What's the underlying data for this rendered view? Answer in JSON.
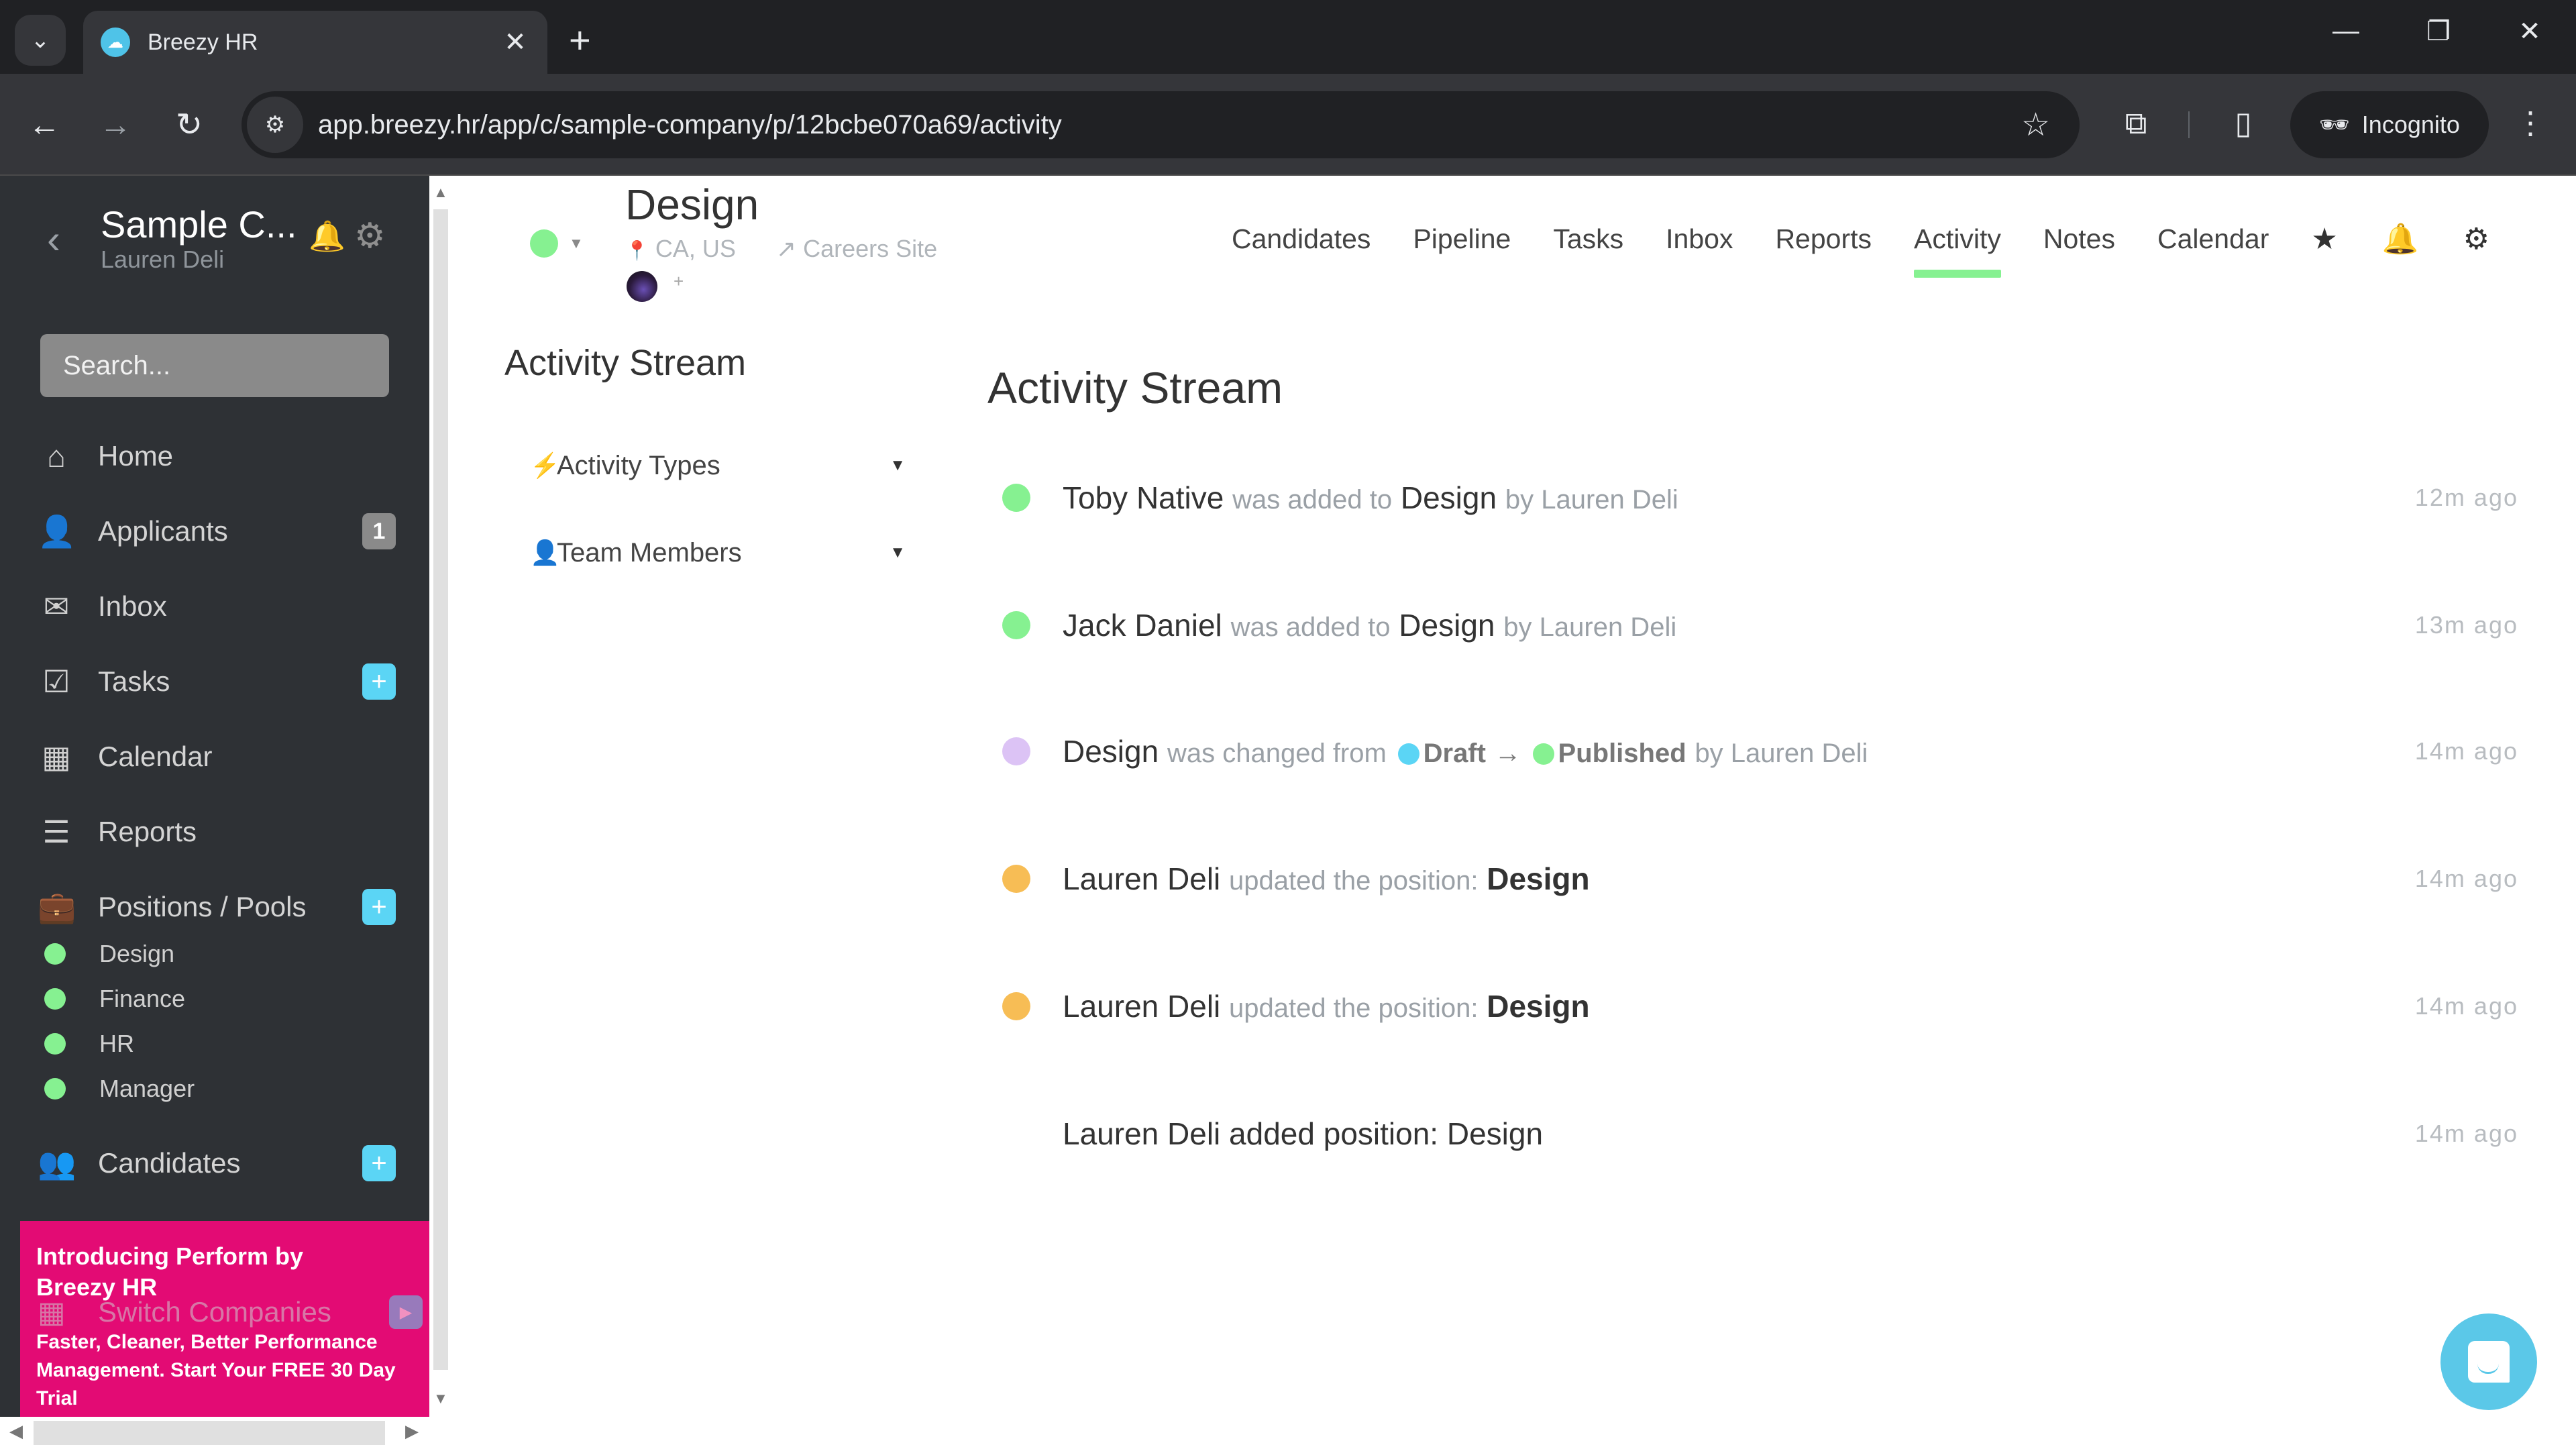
{
  "browser": {
    "tab_title": "Breezy HR",
    "url": "app.breezy.hr/app/c/sample-company/p/12bcbe070a69/activity",
    "incognito_label": "Incognito",
    "icons": {
      "tab_search": "⌄",
      "close": "✕",
      "new_tab": "+",
      "minimize": "—",
      "restore": "❐",
      "window_close": "✕",
      "back": "←",
      "forward": "→",
      "reload": "↻",
      "site_info": "⚙",
      "bookmark": "☆",
      "extensions": "⧉",
      "side_panel": "▯",
      "incognito": "🕶",
      "menu": "⋮"
    }
  },
  "sidebar": {
    "company": "Sample C...",
    "user": "Lauren Deli",
    "search_placeholder": "Search...",
    "icons": {
      "back": "‹",
      "bell": "🔔",
      "gear": "⚙"
    },
    "items": [
      {
        "label": "Home",
        "icon": "⌂"
      },
      {
        "label": "Applicants",
        "icon": "👤",
        "badge": "1"
      },
      {
        "label": "Inbox",
        "icon": "✉"
      },
      {
        "label": "Tasks",
        "icon": "☑",
        "badge": "+"
      },
      {
        "label": "Calendar",
        "icon": "▦"
      },
      {
        "label": "Reports",
        "icon": "☰"
      },
      {
        "label": "Positions / Pools",
        "icon": "💼",
        "badge": "+"
      },
      {
        "label": "Candidates",
        "icon": "👥",
        "badge": "+"
      }
    ],
    "positions": [
      {
        "label": "Design",
        "color": "#86f191"
      },
      {
        "label": "Finance",
        "color": "#86f191"
      },
      {
        "label": "HR",
        "color": "#86f191"
      },
      {
        "label": "Manager",
        "color": "#86f191"
      }
    ],
    "switch_companies": {
      "label": "Switch Companies",
      "icon": "▦",
      "go": "▶"
    },
    "promo": {
      "title": "Introducing Perform by Breezy HR",
      "body": "Faster, Cleaner, Better Performance Management. Start Your FREE 30 Day Trial"
    }
  },
  "position": {
    "title": "Design",
    "status_color": "#86f191",
    "location": "CA, US",
    "careers_link": "Careers Site",
    "icons": {
      "location": "📍",
      "external": "↗",
      "caret": "▼",
      "add": "+"
    }
  },
  "topnav": {
    "links": [
      "Candidates",
      "Pipeline",
      "Tasks",
      "Inbox",
      "Reports",
      "Activity",
      "Notes",
      "Calendar"
    ],
    "active": "Activity",
    "icons": {
      "star": "★",
      "bell": "🔔",
      "gear": "⚙"
    }
  },
  "filters": {
    "title": "Activity Stream",
    "activity_types": {
      "label": "Activity Types",
      "icon": "⚡",
      "caret": "▼"
    },
    "team_members": {
      "label": "Team Members",
      "icon": "👤",
      "caret": "▼"
    }
  },
  "stream": {
    "title": "Activity Stream",
    "entries": [
      {
        "dot": "#86f191",
        "subject": "Toby Native",
        "verb": "was added to",
        "object": "Design",
        "by": "by Lauren Deli",
        "time": "12m ago"
      },
      {
        "dot": "#86f191",
        "subject": "Jack Daniel",
        "verb": "was added to",
        "object": "Design",
        "by": "by Lauren Deli",
        "time": "13m ago"
      },
      {
        "dot": "#dcc3f5",
        "subject": "Design",
        "verb": "was changed from",
        "from_color": "#5bd5f5",
        "from": "Draft",
        "arrow": "→",
        "to_color": "#86f191",
        "to": "Published",
        "by": "by Lauren Deli",
        "time": "14m ago"
      },
      {
        "dot": "#f7bd55",
        "subject": "Lauren Deli",
        "verb": "updated the position:",
        "object": "Design",
        "time": "14m ago"
      },
      {
        "dot": "#f7bd55",
        "subject": "Lauren Deli",
        "verb": "updated the position:",
        "object": "Design",
        "time": "14m ago"
      },
      {
        "text": "Lauren Deli added position: Design",
        "time": "14m ago"
      }
    ]
  },
  "chat_launcher": {
    "icon": "chat-bubble"
  }
}
